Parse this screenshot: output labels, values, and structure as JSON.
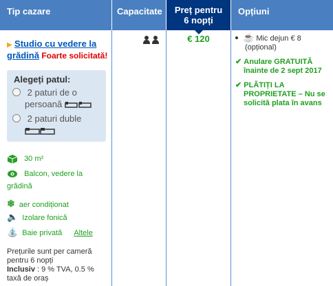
{
  "header": {
    "tip_cazare": "Tip cazare",
    "capacitate": "Capacitate",
    "pret_line1": "Preț pentru",
    "pret_line2": "6 nopți",
    "optiuni": "Opțiuni"
  },
  "room": {
    "name_line1": "Studio cu vedere la",
    "name_line2": "grădină",
    "badge": "Foarte solicitată!"
  },
  "bed": {
    "title": "Alegeți patul:",
    "option1_line1": "2 paturi de o",
    "option1_line2": "persoană",
    "option2": "2 paturi duble"
  },
  "facilities": {
    "size": "30 m²",
    "view_line1": "Balcon, vedere la",
    "view_line2": "grădină",
    "ac": "aer condiționat",
    "soundproof": "Izolare fonică",
    "bath": "Baie privată",
    "more": "Altele"
  },
  "price_note": {
    "line1": "Prețurile sunt per cameră",
    "line2": "pentru 6 nopți",
    "bold": "Inclusiv",
    "rest": " : 9 % TVA, 0.5 %",
    "line4": "taxă de oraș"
  },
  "price": "€ 120",
  "options": {
    "breakfast_line1": "Mic dejun € 8",
    "breakfast_line2": "(opțional)",
    "cancel_line1": "Anulare GRATUITĂ",
    "cancel_line2": "înainte de 2 sept 2017",
    "pay_line1": "PLĂTIȚI LA",
    "pay_line2": "PROPRIETATE – Nu se",
    "pay_line3": "solicită plata în avans"
  },
  "colors": {
    "header": "#4a7fc1",
    "header_selected": "#003580",
    "green": "#20a020",
    "link": "#0057b8",
    "red": "#e00000"
  }
}
